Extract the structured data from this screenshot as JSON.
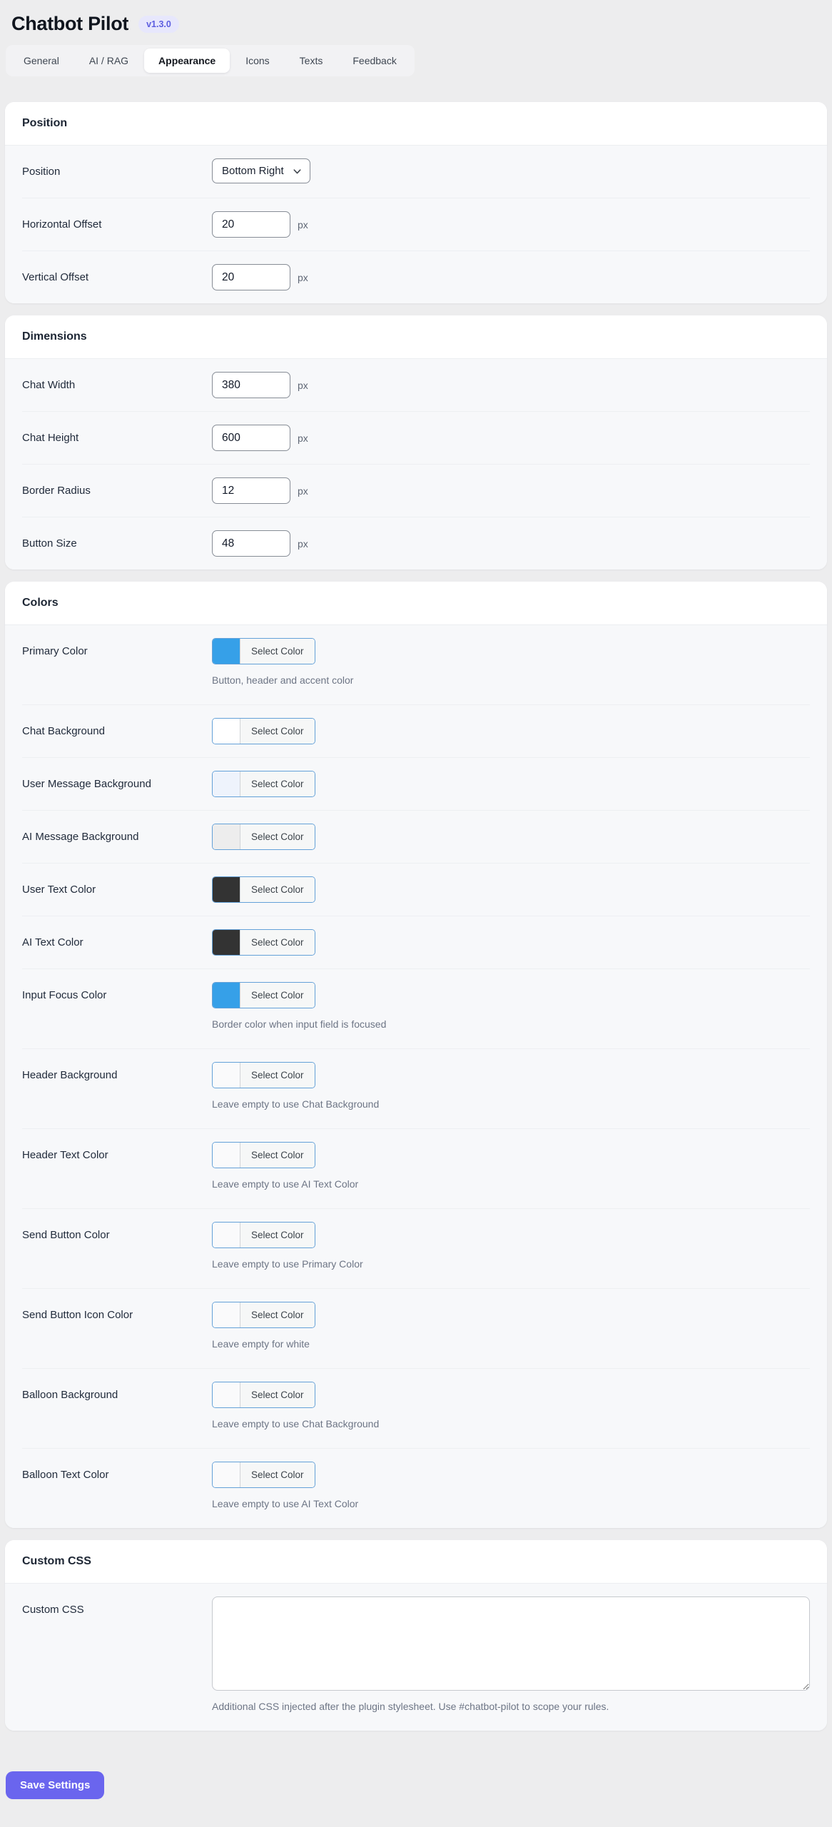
{
  "header": {
    "title": "Chatbot Pilot",
    "version_badge": "v1.3.0"
  },
  "tabs": [
    {
      "label": "General",
      "active": false
    },
    {
      "label": "AI / RAG",
      "active": false
    },
    {
      "label": "Appearance",
      "active": true
    },
    {
      "label": "Icons",
      "active": false
    },
    {
      "label": "Texts",
      "active": false
    },
    {
      "label": "Feedback",
      "active": false
    }
  ],
  "sections": [
    {
      "title": "Position",
      "rows": [
        {
          "label": "Position",
          "control": "select",
          "value": "Bottom Right"
        },
        {
          "label": "Horizontal Offset",
          "control": "number",
          "value": "20",
          "suffix": "px"
        },
        {
          "label": "Vertical Offset",
          "control": "number",
          "value": "20",
          "suffix": "px"
        }
      ]
    },
    {
      "title": "Dimensions",
      "rows": [
        {
          "label": "Chat Width",
          "control": "number",
          "value": "380",
          "suffix": "px"
        },
        {
          "label": "Chat Height",
          "control": "number",
          "value": "600",
          "suffix": "px"
        },
        {
          "label": "Border Radius",
          "control": "number",
          "value": "12",
          "suffix": "px"
        },
        {
          "label": "Button Size",
          "control": "number",
          "value": "48",
          "suffix": "px"
        }
      ]
    },
    {
      "title": "Colors",
      "rows": [
        {
          "label": "Primary Color",
          "control": "color",
          "button_label": "Select Color",
          "swatch": "#36a0e8",
          "hint": "Button, header and accent color"
        },
        {
          "label": "Chat Background",
          "control": "color",
          "button_label": "Select Color",
          "swatch": "#ffffff"
        },
        {
          "label": "User Message Background",
          "control": "color",
          "button_label": "Select Color",
          "swatch": "#eef3fc"
        },
        {
          "label": "AI Message Background",
          "control": "color",
          "button_label": "Select Color",
          "swatch": "#ededed"
        },
        {
          "label": "User Text Color",
          "control": "color",
          "button_label": "Select Color",
          "swatch": "#333333"
        },
        {
          "label": "AI Text Color",
          "control": "color",
          "button_label": "Select Color",
          "swatch": "#333333"
        },
        {
          "label": "Input Focus Color",
          "control": "color",
          "button_label": "Select Color",
          "swatch": "#36a0e8",
          "hint": "Border color when input field is focused"
        },
        {
          "label": "Header Background",
          "control": "color",
          "button_label": "Select Color",
          "swatch": "",
          "hint": "Leave empty to use Chat Background"
        },
        {
          "label": "Header Text Color",
          "control": "color",
          "button_label": "Select Color",
          "swatch": "",
          "hint": "Leave empty to use AI Text Color"
        },
        {
          "label": "Send Button Color",
          "control": "color",
          "button_label": "Select Color",
          "swatch": "",
          "hint": "Leave empty to use Primary Color"
        },
        {
          "label": "Send Button Icon Color",
          "control": "color",
          "button_label": "Select Color",
          "swatch": "",
          "hint": "Leave empty for white"
        },
        {
          "label": "Balloon Background",
          "control": "color",
          "button_label": "Select Color",
          "swatch": "",
          "hint": "Leave empty to use Chat Background"
        },
        {
          "label": "Balloon Text Color",
          "control": "color",
          "button_label": "Select Color",
          "swatch": "",
          "hint": "Leave empty to use AI Text Color"
        }
      ]
    },
    {
      "title": "Custom CSS",
      "rows": [
        {
          "label": "Custom CSS",
          "control": "textarea",
          "value": "",
          "hint": "Additional CSS injected after the plugin stylesheet. Use #chatbot-pilot to scope your rules."
        }
      ]
    }
  ],
  "footer": {
    "save_label": "Save Settings"
  },
  "theme": {
    "accent": "#6a65ee",
    "badge_bg": "#e7e7fc",
    "badge_text": "#5d5ee0",
    "color_button_border": "#64a1d8"
  }
}
